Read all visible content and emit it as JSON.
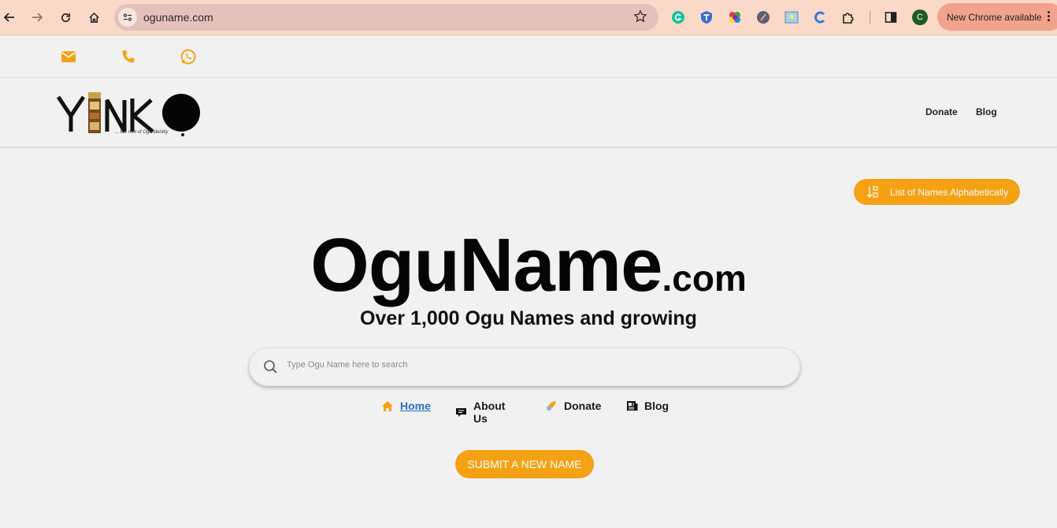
{
  "browser": {
    "url": "oguname.com",
    "update_label": "New Chrome available",
    "profile_initial": "C"
  },
  "contact_bar": {
    "icons": [
      "email-icon",
      "phone-icon",
      "whatsapp-icon"
    ],
    "accent_color": "#f5a114"
  },
  "header": {
    "logo_text": "YINKO",
    "logo_tagline": "... the root of Ogu identity",
    "nav": [
      {
        "label": "Donate"
      },
      {
        "label": "Blog"
      }
    ]
  },
  "main": {
    "alphabetical_button": "List of Names Alphabetically",
    "brand_big": "OguName",
    "brand_small": ".com",
    "subtitle": "Over 1,000 Ogu Names and growing",
    "search": {
      "placeholder": "Type Ogu Name here to search",
      "value": ""
    },
    "mini_nav": [
      {
        "label": "Home",
        "icon": "home-icon",
        "active": true
      },
      {
        "label": "About Us",
        "icon": "chat-icon"
      },
      {
        "label": "Donate",
        "icon": "donate-icon"
      },
      {
        "label": "Blog",
        "icon": "news-icon"
      }
    ],
    "submit_button": "SUBMIT A NEW NAME"
  },
  "colors": {
    "accent": "#f5a114",
    "chrome_bar": "#fbd9c9",
    "link_active": "#2b6fc2",
    "page_bg": "#f1f1f1"
  }
}
